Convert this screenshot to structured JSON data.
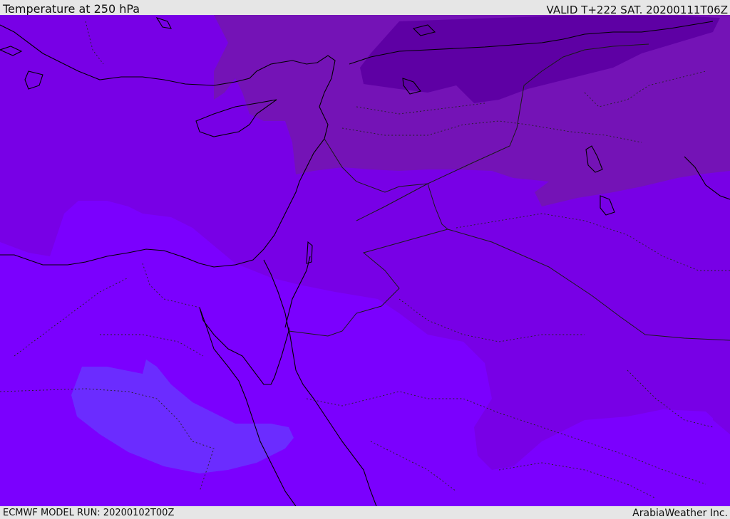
{
  "header": {
    "title": "Temperature at 250 hPa",
    "valid_label": "VALID T+222 SAT. 20200111T06Z"
  },
  "footer": {
    "model_run": "ECMWF MODEL RUN: 20200102T00Z",
    "brand": "ArabiaWeather Inc."
  },
  "colors": {
    "cold_darkest": "#5e00a4",
    "cold_dark": "#7413b6",
    "cold_mid": "#7300d6",
    "mid": "#7900e8",
    "warm": "#7c00ff",
    "warmest": "#6b2cff",
    "coastline": "#000000",
    "border": "#1a1a1a",
    "header_bg": "#e6e6e6"
  },
  "map": {
    "field": "temperature",
    "level_hpa": 250
  }
}
